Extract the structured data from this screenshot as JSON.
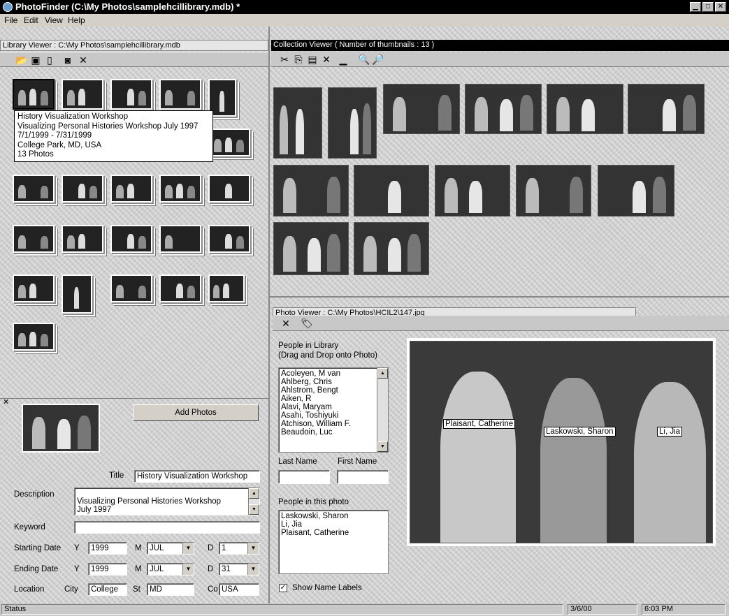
{
  "window": {
    "title": "PhotoFinder (C:\\My Photos\\samplehcillibrary.mdb) *"
  },
  "menu": [
    {
      "label": "File"
    },
    {
      "label": "Edit"
    },
    {
      "label": "View"
    },
    {
      "label": "Help"
    }
  ],
  "library_viewer": {
    "header": "Library Viewer : C:\\My Photos\\samplehcillibrary.mdb",
    "toolbar_icons": [
      "open-folder-icon",
      "save-icon",
      "new-file-icon",
      "camera-icon",
      "delete-icon"
    ],
    "tooltip": [
      "History Visualization Workshop",
      "Visualizing Personal Histories Workshop July 1997",
      "7/1/1999 - 7/31/1999",
      "College Park, MD, USA",
      "13 Photos"
    ]
  },
  "collection_viewer": {
    "header": "Collection Viewer ( Number of thumbnails : 13 )",
    "toolbar_icons": [
      "cut-icon",
      "copy-icon",
      "paste-icon",
      "delete-icon",
      "blank-icon",
      "zoom-in-icon",
      "zoom-out-icon"
    ]
  },
  "photo_viewer": {
    "header": "Photo Viewer : C:\\My Photos\\HCIL2\\147.jpg",
    "toolbar_icons": [
      "delete-icon",
      "label-icon"
    ],
    "people_in_library_label": "People in Library\n(Drag and Drop onto Photo)",
    "people_in_library": [
      "Acoleyen, M van",
      "Ahlberg, Chris",
      "Ahlstrom, Bengt",
      "Aiken, R",
      "Alavi, Maryam",
      "Asahi, Toshiyuki",
      "Atchison, William F.",
      "Beaudoin, Luc"
    ],
    "last_name_label": "Last Name",
    "first_name_label": "First Name",
    "last_name_value": "",
    "first_name_value": "",
    "people_in_photo_label": "People in this photo",
    "people_in_photo": [
      "Laskowski, Sharon",
      "Li, Jia",
      "Plaisant, Catherine"
    ],
    "show_name_labels": "Show Name Labels",
    "show_name_labels_checked": true,
    "name_labels": [
      "Plaisant, Catherine",
      "Laskowski, Sharon",
      "Li, Jia"
    ]
  },
  "collection_form": {
    "add_photos": "Add Photos",
    "title_label": "Title",
    "title_value": "History Visualization Workshop",
    "description_label": "Description",
    "description_value": "Visualizing Personal Histories Workshop\nJuly 1997",
    "keyword_label": "Keyword",
    "keyword_value": "",
    "starting_date_label": "Starting Date",
    "ending_date_label": "Ending Date",
    "y_label": "Y",
    "m_label": "M",
    "d_label": "D",
    "start_year": "1999",
    "start_month": "JUL",
    "start_day": "1",
    "end_year": "1999",
    "end_month": "JUL",
    "end_day": "31",
    "location_label": "Location",
    "city_label": "City",
    "city_value": "College",
    "st_label": "St",
    "st_value": "MD",
    "co_label": "Co",
    "co_value": "USA"
  },
  "statusbar": {
    "status": "Status",
    "date": "3/6/00",
    "time": "6:03 PM"
  }
}
